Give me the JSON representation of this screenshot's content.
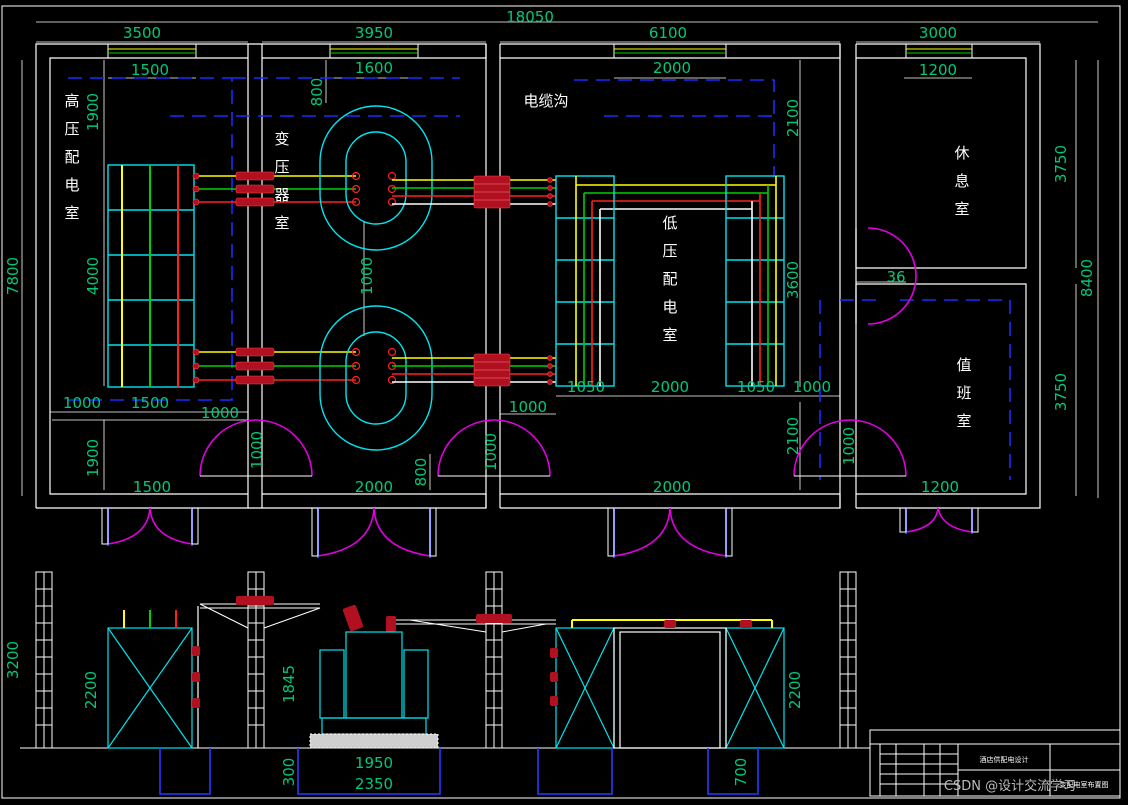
{
  "drawing": {
    "dims": {
      "total_width": "18050",
      "sec_high_voltage": "3500",
      "sec_transformer": "3950",
      "sec_low_voltage": "6100",
      "sec_rest": "3000",
      "window_1": "1500",
      "window_2": "1600",
      "window_3": "2000",
      "window_4": "1200",
      "height_left": "7800",
      "height_right": "8400",
      "hv_top_gap": "1900",
      "hv_panel_len": "4000",
      "hv_bottom_gap": "1900",
      "hv_left_gap": "1000",
      "hv_panel_w": "1500",
      "hv_right_gap": "1000",
      "tr_top": "800",
      "tr_spacing": "1000",
      "tr_door": "1000",
      "tr_bottom": "800",
      "lv_door": "1000",
      "lv_left_gap": "1000",
      "lv_panel_left": "1050",
      "lv_mid": "2000",
      "lv_panel_right": "1050",
      "lv_right_gap": "1000",
      "lv_top": "2100",
      "lv_panel_len": "3600",
      "lv_bottom": "2100",
      "duty_door": "1000",
      "rest_h": "3750",
      "duty_h": "3750",
      "door_gap": "36",
      "door_1": "1500",
      "door_2": "2000",
      "door_3": "2000",
      "door_4": "1200",
      "elev_h": "3200",
      "elev_cab_h": "2200",
      "elev_tr_h": "1845",
      "elev_tr_w": "1950",
      "elev_base_w": "2350",
      "elev_base_h": "300",
      "elev_lv_h": "2200",
      "elev_trench": "700"
    },
    "rooms": {
      "hv": [
        "高",
        "压",
        "配",
        "电",
        "室"
      ],
      "transformer": [
        "变",
        "压",
        "器",
        "室"
      ],
      "cable_trench": "电缆沟",
      "lv": [
        "低",
        "压",
        "配",
        "电",
        "室"
      ],
      "rest": [
        "休",
        "息",
        "室"
      ],
      "duty": [
        "值",
        "班",
        "室"
      ]
    },
    "title_block": {
      "project": "酒店供配电设计",
      "drawing_name": "变配电室布置图"
    },
    "watermark": "CSDN @设计交流学习"
  },
  "colors": {
    "wall": "#ffffff",
    "cyan": "#00e5ee",
    "dashed": "#1b2bff",
    "yellow": "#ffff00",
    "green": "#00d000",
    "red": "#ff2020",
    "insulator": "#b01020",
    "door_arc": "#e000e0",
    "door_leaf": "#2838ff",
    "dim_text": "#00c87a"
  }
}
